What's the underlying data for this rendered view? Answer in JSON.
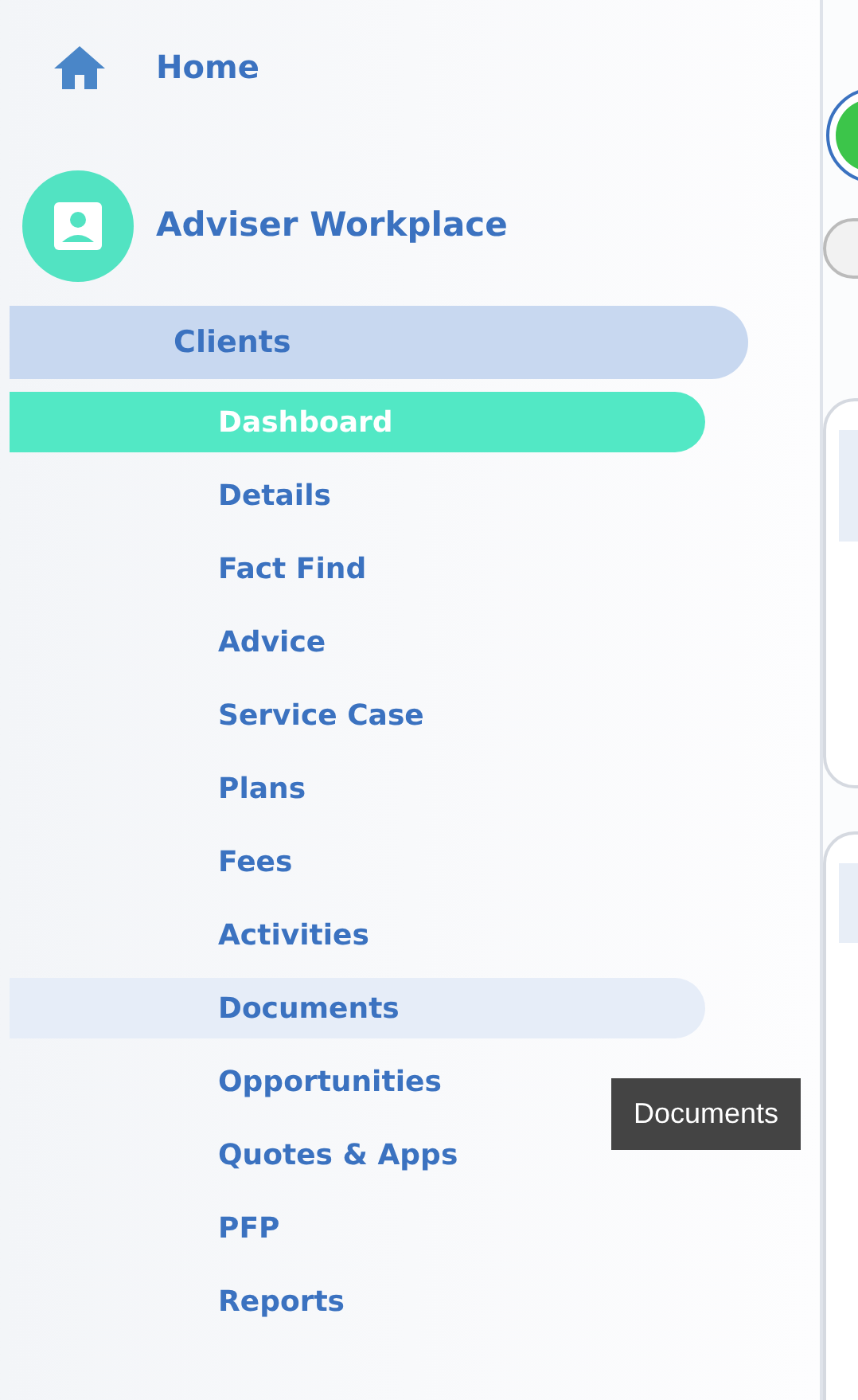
{
  "sidebar": {
    "home": {
      "label": "Home"
    },
    "workspace": {
      "label": "Adviser Workplace"
    },
    "section": {
      "label": "Clients"
    },
    "items": [
      {
        "label": "Dashboard",
        "selected": true,
        "hovered": false
      },
      {
        "label": "Details",
        "selected": false,
        "hovered": false
      },
      {
        "label": "Fact Find",
        "selected": false,
        "hovered": false
      },
      {
        "label": "Advice",
        "selected": false,
        "hovered": false
      },
      {
        "label": "Service Case",
        "selected": false,
        "hovered": false
      },
      {
        "label": "Plans",
        "selected": false,
        "hovered": false
      },
      {
        "label": "Fees",
        "selected": false,
        "hovered": false
      },
      {
        "label": "Activities",
        "selected": false,
        "hovered": false
      },
      {
        "label": "Documents",
        "selected": false,
        "hovered": true
      },
      {
        "label": "Opportunities",
        "selected": false,
        "hovered": false
      },
      {
        "label": "Quotes & Apps",
        "selected": false,
        "hovered": false
      },
      {
        "label": "PFP",
        "selected": false,
        "hovered": false
      },
      {
        "label": "Reports",
        "selected": false,
        "hovered": false
      }
    ]
  },
  "tooltip": {
    "text": "Documents"
  }
}
